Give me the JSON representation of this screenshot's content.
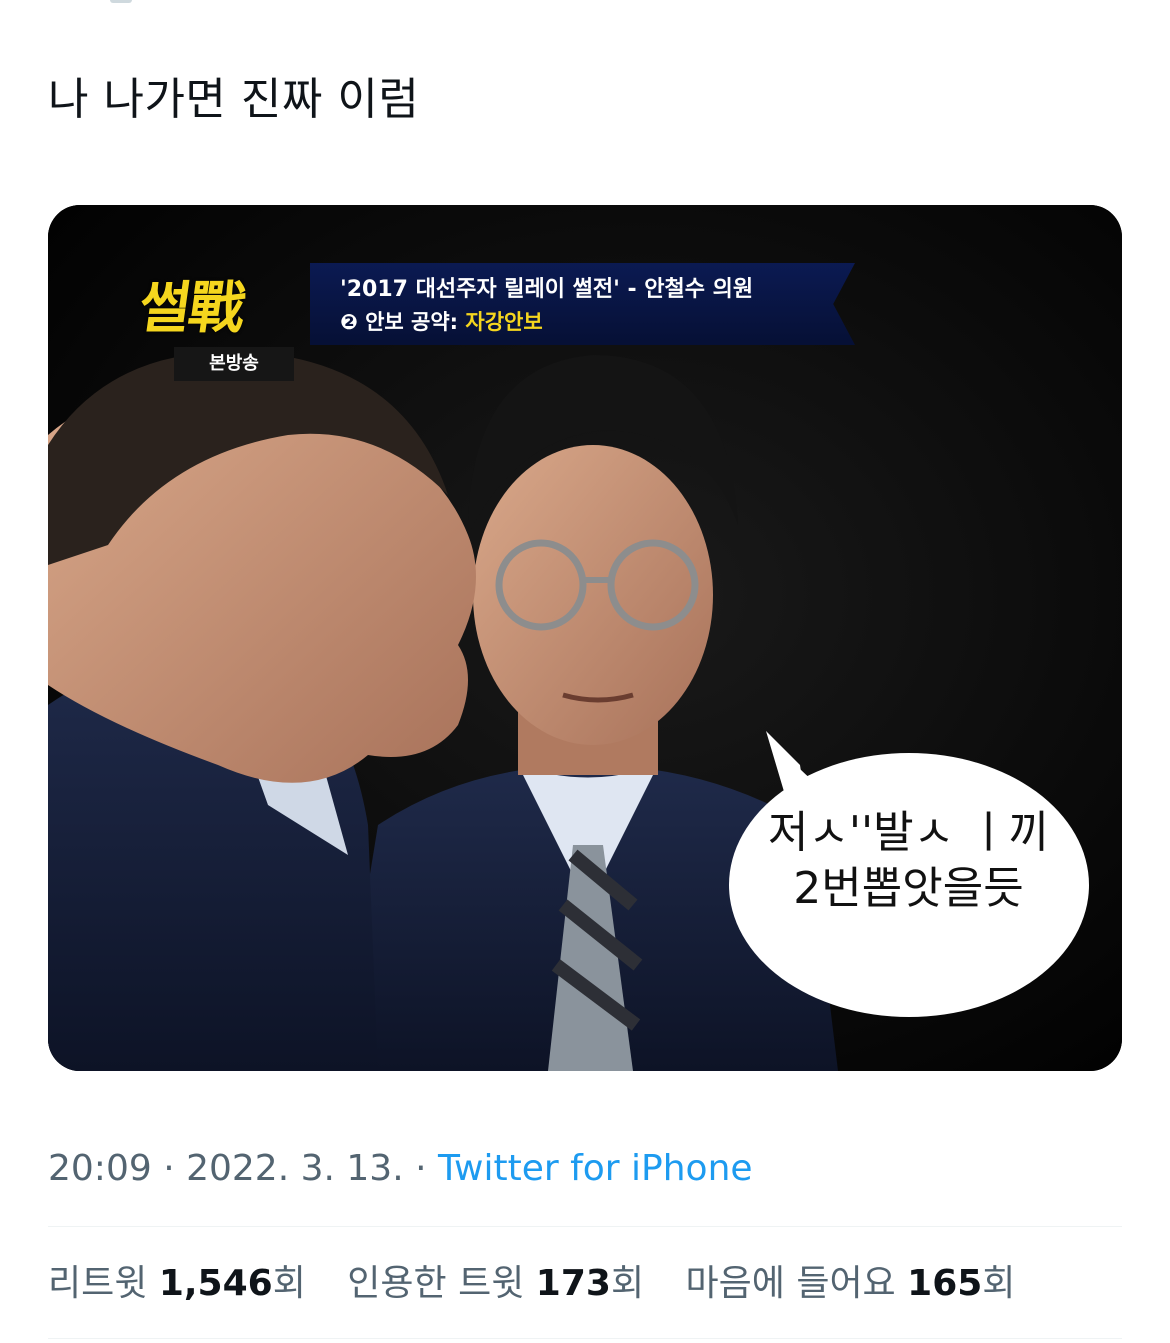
{
  "tweet": {
    "text": "나 나가면 진짜 이럼"
  },
  "media": {
    "logo": "썰戰",
    "logo_sub": "본방송",
    "banner_line1": "'2017 대선주자 릴레이 썰전' - 안철수 의원",
    "banner_line2_prefix": "❷ 안보 공약: ",
    "banner_line2_highlight": "자강안보",
    "bubble_line1": "저ㅅ''발ㅅ ㅣ끼",
    "bubble_line2": "2번뽑앗을듯"
  },
  "meta": {
    "time": "20:09",
    "separator1": " · ",
    "date": "2022. 3. 13.",
    "separator2": " · ",
    "source": "Twitter for iPhone"
  },
  "stats": {
    "retweets_label": "리트윗",
    "retweets_count": "1,546",
    "retweets_suffix": "회",
    "quotes_label": "인용한 트윗",
    "quotes_count": "173",
    "quotes_suffix": "회",
    "likes_label": "마음에 들어요",
    "likes_count": "165",
    "likes_suffix": "회"
  },
  "colors": {
    "link": "#1d9bf0",
    "muted": "#536471",
    "logo_yellow": "#f5d61e",
    "banner_navy": "#0b1a52"
  }
}
